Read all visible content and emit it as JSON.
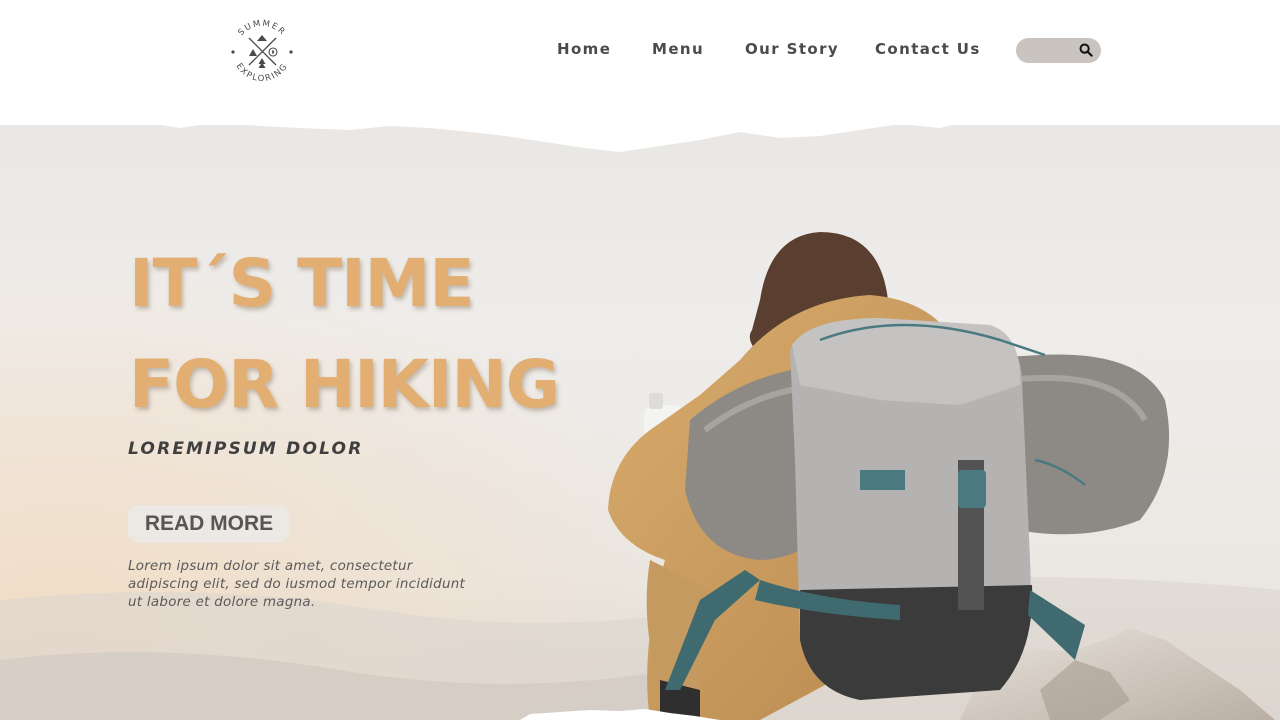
{
  "brand": {
    "logo_top_text": "SUMMER",
    "logo_bottom_text": "EXPLORING",
    "logo_icons": [
      "tent-icon",
      "compass-icon",
      "tree-icon",
      "mountain-icon"
    ]
  },
  "nav": {
    "items": [
      {
        "label": "Home"
      },
      {
        "label": "Menu"
      },
      {
        "label": "Our Story"
      },
      {
        "label": "Contact Us"
      }
    ]
  },
  "search": {
    "value": "",
    "placeholder": "",
    "icon": "search-icon"
  },
  "hero": {
    "headline_line1": "IT´S TIME",
    "headline_line2": "FOR HIKING",
    "subheading": "LOREMIPSUM  DOLOR",
    "cta_label": "READ MORE",
    "body_lines": [
      "Lorem ipsum dolor sit amet, consectetur",
      "adipiscing elit, sed do iusmod tempor incididunt",
      "ut labore et dolore magna."
    ],
    "image_subject": "hiker-with-backpack-image"
  },
  "colors": {
    "accent": "#e2ae72",
    "nav_text": "#4b4b4b",
    "search_bg": "#c9c4bf",
    "button_bg": "#ece8e4",
    "sky": "#eeebe8"
  }
}
